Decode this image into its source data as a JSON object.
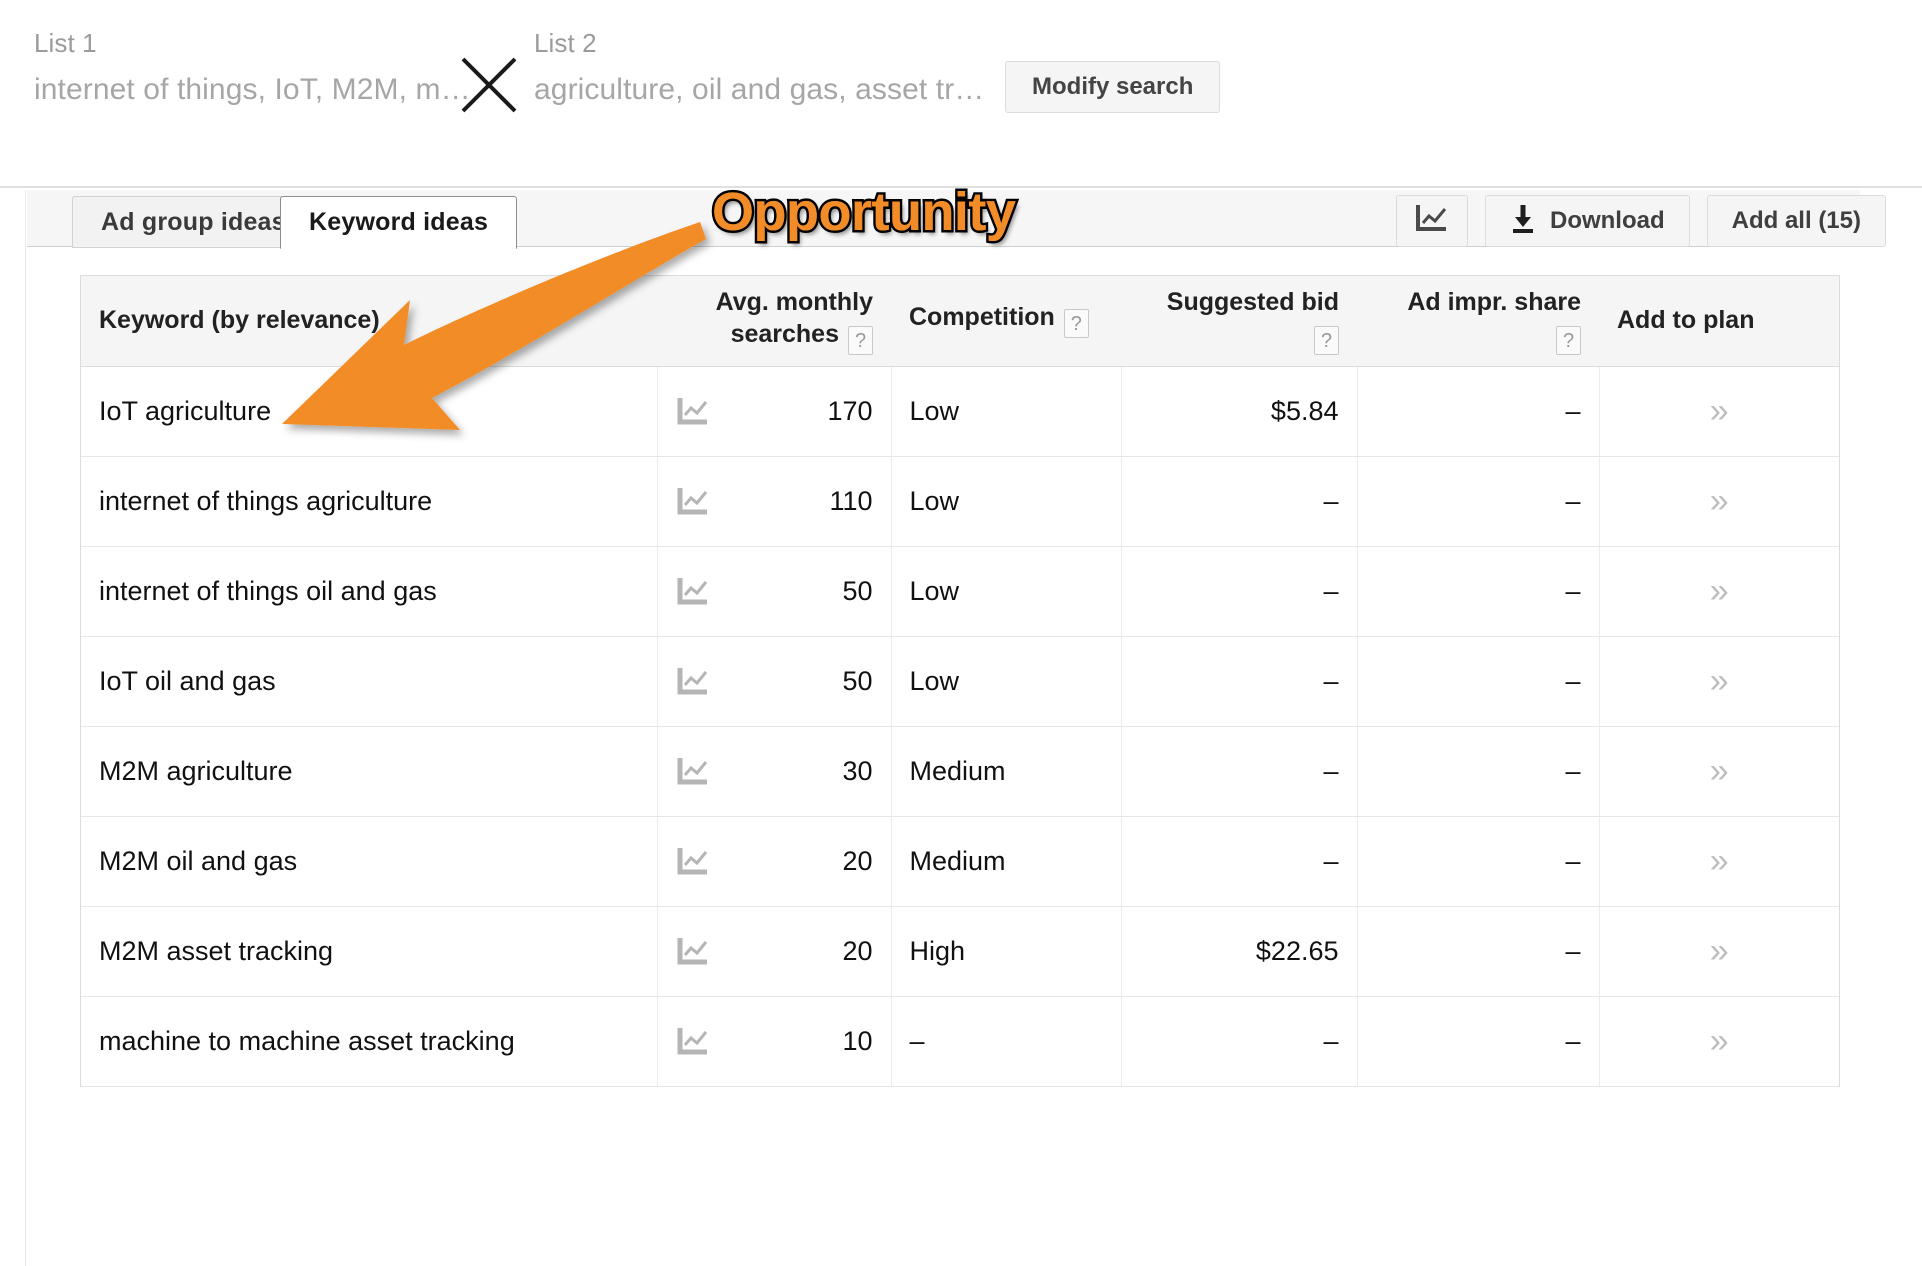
{
  "search_bar": {
    "list1": {
      "title": "List 1",
      "value": "internet of things, IoT, M2M, m…"
    },
    "list2": {
      "title": "List 2",
      "value": "agriculture, oil and gas, asset tr…"
    },
    "separator_icon": "x-icon",
    "modify_button": "Modify search"
  },
  "tabs": [
    {
      "label": "Ad group ideas",
      "active": false
    },
    {
      "label": "Keyword ideas",
      "active": true
    }
  ],
  "toolbar": {
    "chart_toggle_icon": "line-chart-icon",
    "download_label": "Download",
    "download_icon": "download-icon",
    "add_all_label": "Add all (15)"
  },
  "annotation": {
    "label": "Opportunity",
    "color": "#F28C28",
    "outline_color": "#000000",
    "arrow": "arrow-pointing-down-left"
  },
  "table": {
    "columns": [
      {
        "label": "Keyword (by relevance)",
        "help": false,
        "align": "left"
      },
      {
        "label_line1": "Avg. monthly",
        "label_line2": "searches",
        "help": true,
        "align": "right"
      },
      {
        "label": "Competition",
        "help": true,
        "align": "left"
      },
      {
        "label": "Suggested bid",
        "help": true,
        "align": "right"
      },
      {
        "label": "Ad impr. share",
        "help": true,
        "align": "right"
      },
      {
        "label": "Add to plan",
        "help": false,
        "align": "left"
      }
    ],
    "help_glyph": "?",
    "row_chart_icon": "line-chart-icon",
    "row_add_icon": "double-chevron-right-icon",
    "rows": [
      {
        "keyword": "IoT agriculture",
        "searches": "170",
        "competition": "Low",
        "bid": "$5.84",
        "impr_share": "–"
      },
      {
        "keyword": "internet of things agriculture",
        "searches": "110",
        "competition": "Low",
        "bid": "–",
        "impr_share": "–"
      },
      {
        "keyword": "internet of things oil and gas",
        "searches": "50",
        "competition": "Low",
        "bid": "–",
        "impr_share": "–"
      },
      {
        "keyword": "IoT oil and gas",
        "searches": "50",
        "competition": "Low",
        "bid": "–",
        "impr_share": "–"
      },
      {
        "keyword": "M2M agriculture",
        "searches": "30",
        "competition": "Medium",
        "bid": "–",
        "impr_share": "–"
      },
      {
        "keyword": "M2M oil and gas",
        "searches": "20",
        "competition": "Medium",
        "bid": "–",
        "impr_share": "–"
      },
      {
        "keyword": "M2M asset tracking",
        "searches": "20",
        "competition": "High",
        "bid": "$22.65",
        "impr_share": "–"
      },
      {
        "keyword": "machine to machine asset tracking",
        "searches": "10",
        "competition": "–",
        "bid": "–",
        "impr_share": "–"
      }
    ]
  }
}
